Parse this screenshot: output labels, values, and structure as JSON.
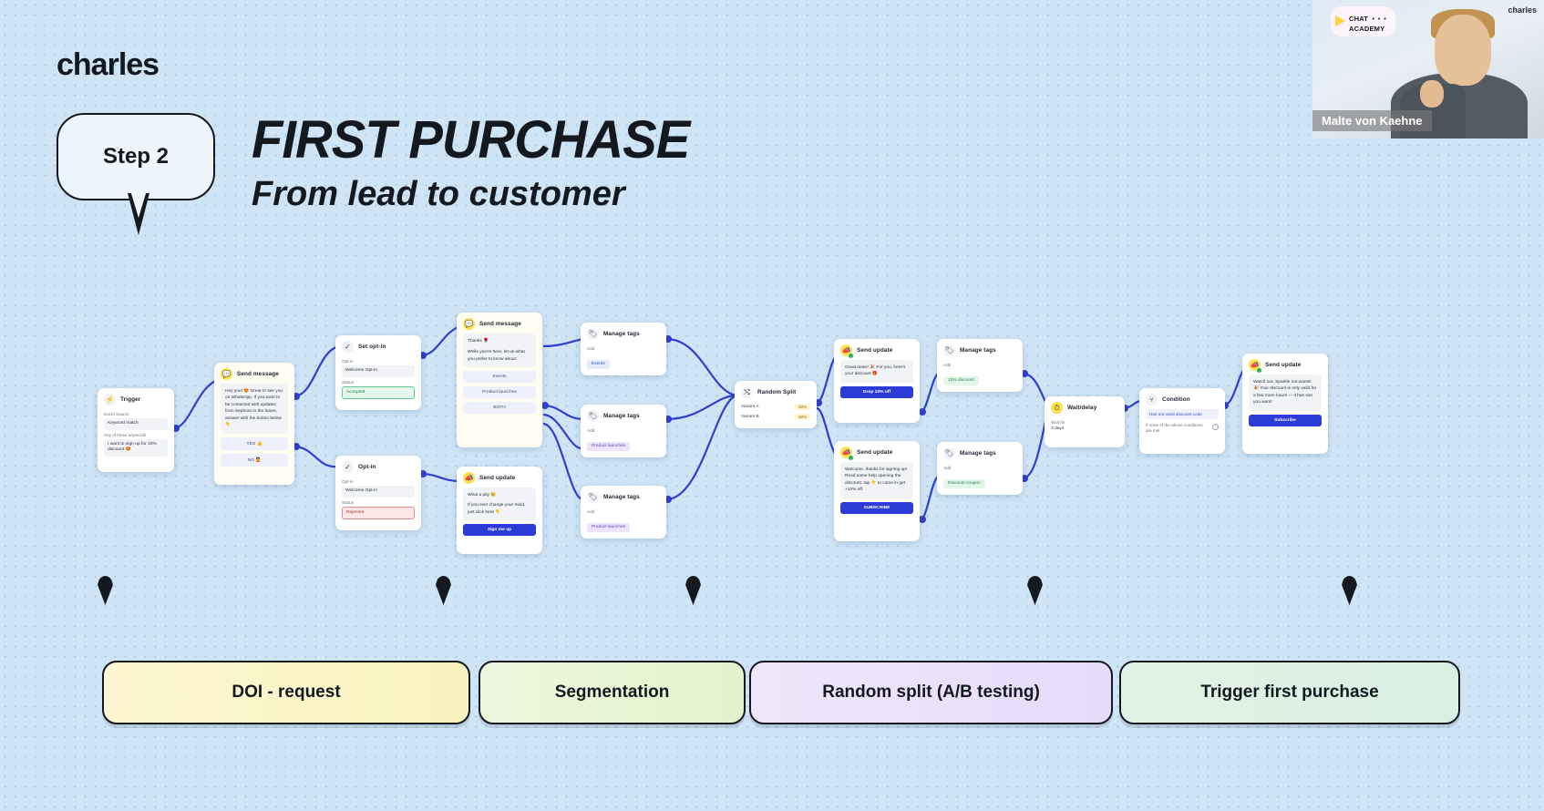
{
  "header": {
    "brand": "charles",
    "step_badge": "Step 2",
    "title": "FIRST PURCHASE",
    "subtitle": "From lead to customer"
  },
  "video": {
    "badge_line1": "CHAT",
    "badge_dots": "• • •",
    "badge_line2": "ACADEMY",
    "brand": "charles",
    "speaker_name": "Malte von Kaehne"
  },
  "legend": [
    {
      "label": "DOI - request"
    },
    {
      "label": "Segmentation"
    },
    {
      "label": "Random split (A/B testing)"
    },
    {
      "label": "Trigger first purchase"
    }
  ],
  "flow": {
    "trigger": {
      "title": "Trigger",
      "icon": "trigger-icon",
      "field1_label": "Event Source",
      "field1_value": "Keyword match",
      "field2_label": "Any of these keywords",
      "field2_value": "I want to sign up for 10% discount 😍"
    },
    "send_message_1": {
      "title": "Send message",
      "icon": "message-icon",
      "message": "Hey you! 😍 Great to see you on WhatsApp. If you want to be contacted with updates from Sephora in the future, answer with the button below 👇",
      "button1": "YES 👍",
      "button2": "NO 🙅"
    },
    "set_opt_in": {
      "title": "Set opt-in",
      "icon": "opt-in-icon",
      "field1_label": "Opt-in",
      "field1_value": "Welcome Opt-in",
      "field2_label": "Status",
      "field2_value": "Accepted"
    },
    "opt_in_rejected": {
      "title": "Opt-in",
      "icon": "opt-in-icon",
      "field1_label": "Opt-in",
      "field1_value": "Welcome Opt-in",
      "field2_label": "Status",
      "field2_value": "Rejected"
    },
    "send_message_2": {
      "title": "Send message",
      "icon": "message-icon",
      "message_line1": "Thanks 🌹",
      "message_line2": "While you're here, let us what you prefer to know about:",
      "button1": "Events",
      "button2": "Product launches",
      "button3": "BOTH"
    },
    "send_update_signup": {
      "title": "Send update",
      "icon": "update-icon",
      "message_line1": "What a pity 😢",
      "message_line2": "If you ever change your mind, just click here 👇",
      "button": "Sign me up"
    },
    "manage_tags_1": {
      "title": "Manage tags",
      "icon": "tag-icon",
      "field_label": "Add",
      "tag": "Events"
    },
    "manage_tags_2": {
      "title": "Manage tags",
      "icon": "tag-icon",
      "field_label": "Add",
      "tag": "Product launches"
    },
    "manage_tags_3": {
      "title": "Manage tags",
      "icon": "tag-icon",
      "field_label": "Add",
      "tag": "Product launches"
    },
    "random_split": {
      "title": "Random Split",
      "icon": "shuffle-icon",
      "row1_label": "Variant A",
      "row1_value": "50%",
      "row2_label": "Variant B",
      "row2_value": "50%"
    },
    "send_update_a": {
      "title": "Send update",
      "icon": "update-icon",
      "message": "Great news! 🎉 For you, here's your discount 🎁",
      "button": "Drop 10% off"
    },
    "send_update_b": {
      "title": "Send update",
      "icon": "update-icon",
      "message": "Welcome, thanks for signing up! Read some help opening the discount, tap 👇 to come in get +10% off.",
      "button": "SUBSCRIBE"
    },
    "manage_tags_4": {
      "title": "Manage tags",
      "icon": "tag-icon",
      "field_label": "Add",
      "tag": "10% discount"
    },
    "manage_tags_5": {
      "title": "Manage tags",
      "icon": "tag-icon",
      "field_label": "Add",
      "tag": "Discount coupon"
    },
    "wait_delay": {
      "title": "Wait/delay",
      "icon": "clock-icon",
      "field_label": "Wait for",
      "field_value": "3 days"
    },
    "condition": {
      "title": "Condition",
      "icon": "condition-icon",
      "link": "Has not used discount code",
      "option": "If none of the above conditions are met"
    },
    "send_update_final": {
      "title": "Send update",
      "icon": "update-icon",
      "message": "Watch out, Sparkle not wants! 🎉 Your discount is only valid for a few more hours — it has sun you want!",
      "button": "Subscribe"
    }
  }
}
